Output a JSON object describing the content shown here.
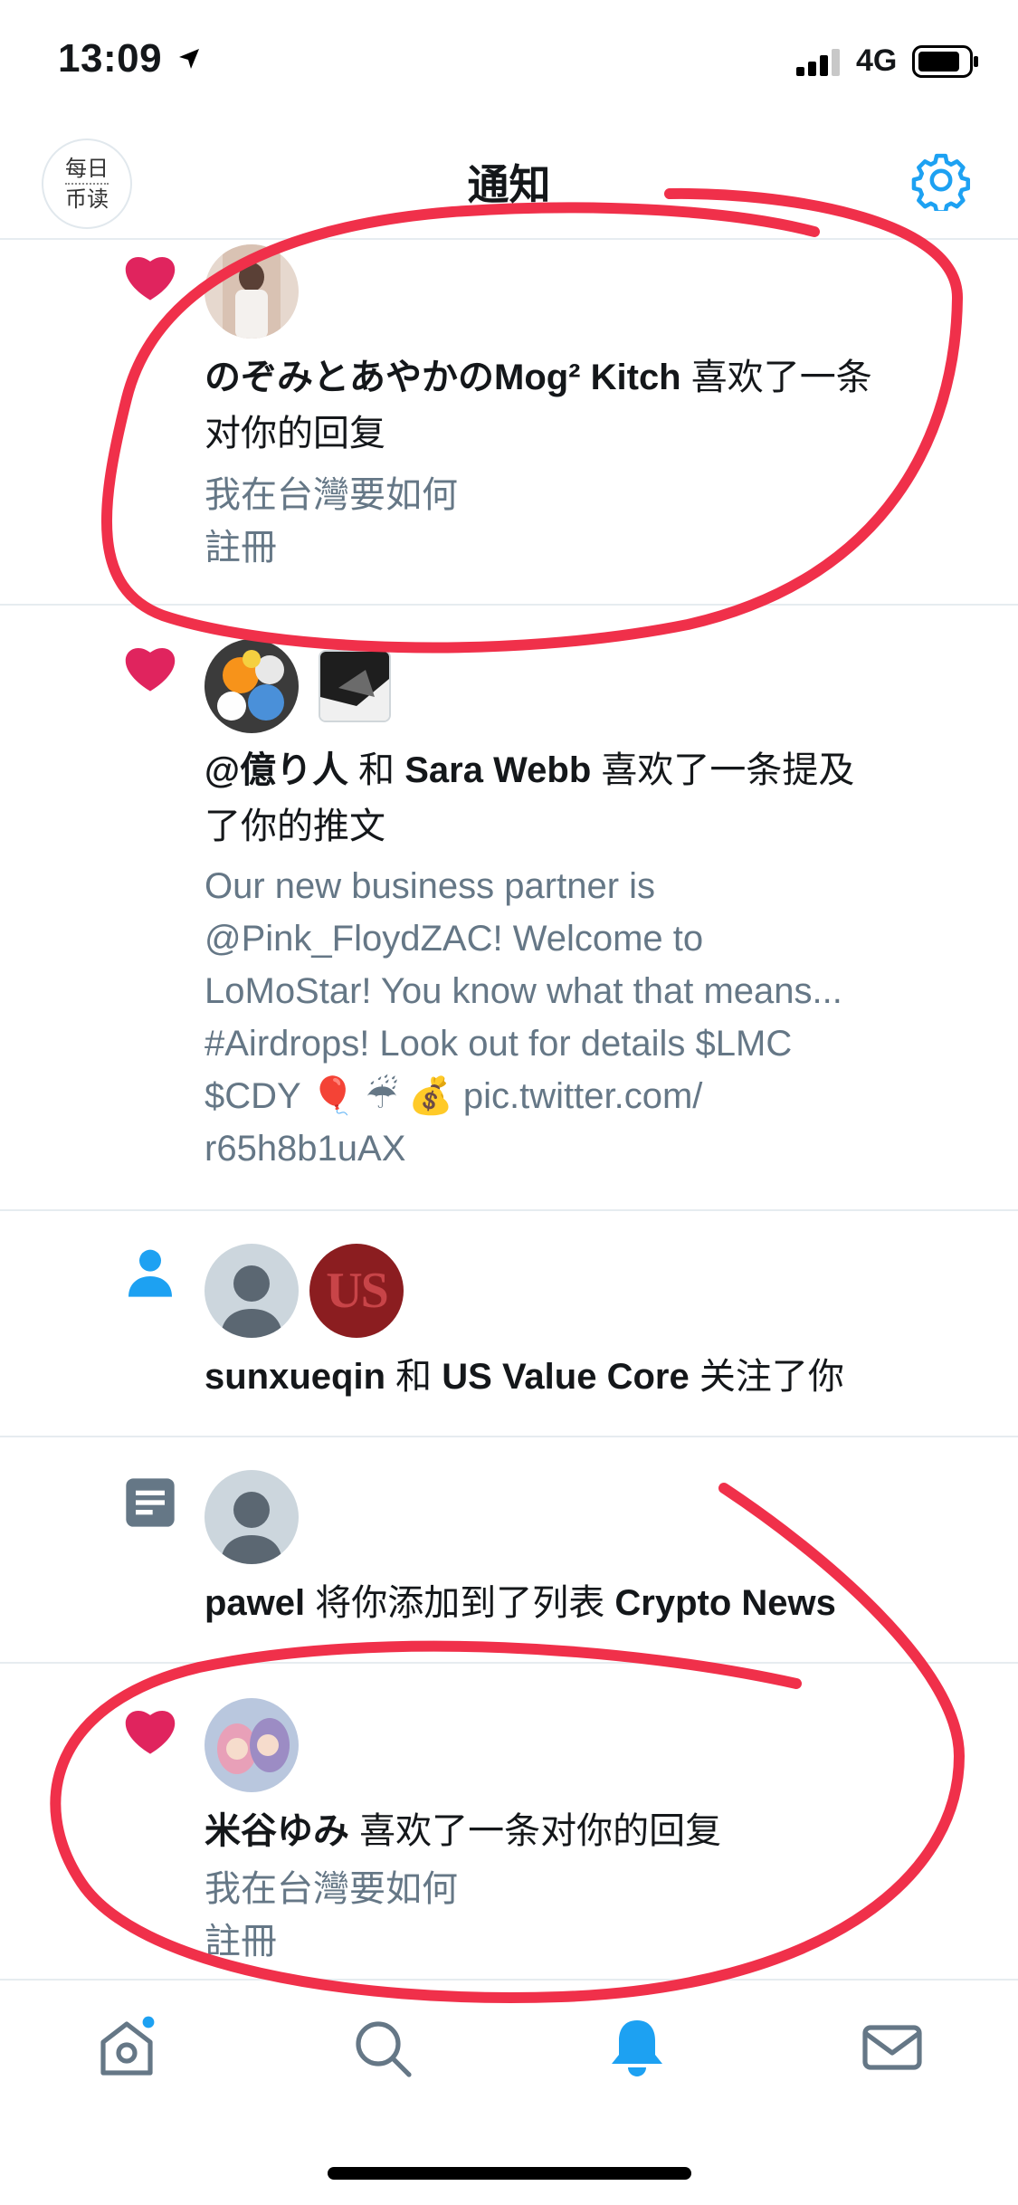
{
  "status_bar": {
    "time": "13:09",
    "network": "4G"
  },
  "header": {
    "logo_line1": "每日",
    "logo_line2": "币读",
    "title": "通知"
  },
  "notifications": [
    {
      "type": "like",
      "line1_actor": "のぞみとあやかのMog² Kitch",
      "line1_rest": " 喜欢了一条",
      "line2": "对你的回复",
      "sub1": "我在台灣要如何",
      "sub2": "註冊"
    },
    {
      "type": "like",
      "line1_actor1": "@億り人",
      "line1_and": " 和 ",
      "line1_actor2": "Sara Webb",
      "line1_rest": " 喜欢了一条提及",
      "line2": "了你的推文",
      "sub_lines": [
        "Our new business partner is",
        "@Pink_FloydZAC! Welcome to",
        "LoMoStar! You know what that means...",
        "#Airdrops! Look out for details $LMC",
        "$CDY 🎈 ☔ 💰 pic.twitter.com/",
        "r65h8b1uAX"
      ]
    },
    {
      "type": "follow",
      "actor1": "sunxueqin",
      "and": " 和 ",
      "actor2": "US Value Core",
      "rest": " 关注了你",
      "avatar2_text": "US"
    },
    {
      "type": "list",
      "actor": "pawel",
      "rest": " 将你添加到了列表 ",
      "list_name": "Crypto News"
    },
    {
      "type": "like",
      "actor": "米谷ゆみ",
      "rest": " 喜欢了一条对你的回复",
      "sub1": "我在台灣要如何",
      "sub2": "註冊"
    }
  ],
  "tab_bar": [
    "home-icon",
    "search-icon",
    "notifications-bell-icon",
    "messages-mail-icon"
  ],
  "colors": {
    "accent": "#1da1f2",
    "like": "#e0245e",
    "annotation": "#f0304a",
    "secondary_text": "#657786"
  }
}
